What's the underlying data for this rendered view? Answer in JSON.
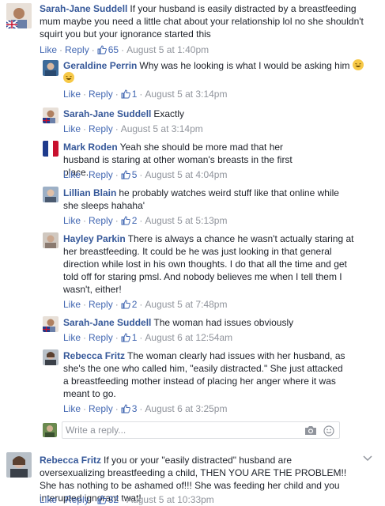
{
  "comments": [
    {
      "author": "Sarah-Jane Suddell",
      "text": "If your husband is easily distracted by a breastfeeding mum maybe you need a little chat about your relationship lol no she shouldn't squirt you but your ignorance started this",
      "like": "Like",
      "reply": "Reply",
      "likes": "65",
      "time": "August 5 at 1:40pm"
    }
  ],
  "replies": [
    {
      "author": "Geraldine Perrin",
      "text": "Why was he looking is what I would be asking him",
      "like": "Like",
      "reply": "Reply",
      "likes": "1",
      "time": "August 5 at 3:14pm"
    },
    {
      "author": "Sarah-Jane Suddell",
      "text": "Exactly",
      "like": "Like",
      "reply": "Reply",
      "likes": "",
      "time": "August 5 at 3:14pm"
    },
    {
      "author": "Mark Roden",
      "text": "Yeah she should be more mad that her husband is staring at other woman's breasts in the first place.",
      "like": "Like",
      "reply": "Reply",
      "likes": "5",
      "time": "August 5 at 4:04pm"
    },
    {
      "author": "Lillian Blain",
      "text": "he probably watches weird stuff like that online while she sleeps hahaha'",
      "like": "Like",
      "reply": "Reply",
      "likes": "2",
      "time": "August 5 at 5:13pm"
    },
    {
      "author": "Hayley Parkin",
      "text": "There is always a chance he wasn't actually staring at her breastfeeding. It could be he was just looking in that general direction while lost in his own thoughts. I do that all the time and get told off for staring pmsl. And nobody believes me when I tell them I wasn't, either!",
      "like": "Like",
      "reply": "Reply",
      "likes": "2",
      "time": "August 5 at 7:48pm"
    },
    {
      "author": "Sarah-Jane Suddell",
      "text": "The woman had issues obviously",
      "like": "Like",
      "reply": "Reply",
      "likes": "1",
      "time": "August 6 at 12:54am"
    },
    {
      "author": "Rebecca Fritz",
      "text": "The woman clearly had issues with her husband, as she's the one who called him, \"easily distracted.\" She just attacked a breastfeeding mother instead of placing her anger where it was meant to go.",
      "like": "Like",
      "reply": "Reply",
      "likes": "3",
      "time": "August 6 at 3:25pm"
    }
  ],
  "reply_box": {
    "placeholder": "Write a reply..."
  },
  "bottom_comment": {
    "author": "Rebecca Fritz",
    "text": "If you or your \"easily distracted\" husband are oversexualizing breastfeeding a child, THEN YOU ARE THE PROBLEM!! She has nothing to be ashamed of!!! She was feeding her child and you interupted ignorant twat!",
    "like": "Like",
    "reply": "Reply",
    "likes": "32",
    "time": "August 5 at 10:33pm"
  },
  "colors": {
    "author": "#365899",
    "action": "#4267b2",
    "meta": "#90949c",
    "text": "#1d2129"
  }
}
